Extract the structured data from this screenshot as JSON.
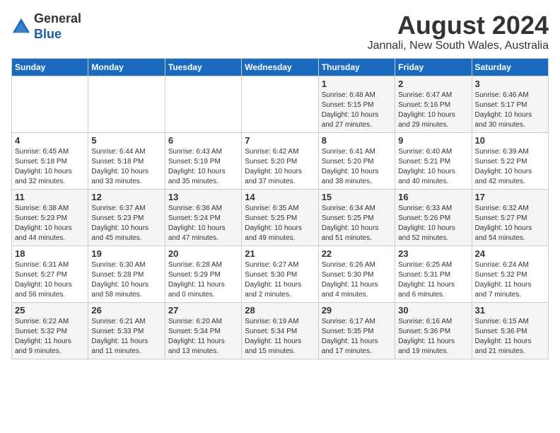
{
  "logo": {
    "general": "General",
    "blue": "Blue"
  },
  "title": {
    "month_year": "August 2024",
    "location": "Jannali, New South Wales, Australia"
  },
  "days_of_week": [
    "Sunday",
    "Monday",
    "Tuesday",
    "Wednesday",
    "Thursday",
    "Friday",
    "Saturday"
  ],
  "weeks": [
    [
      {
        "day": "",
        "info": ""
      },
      {
        "day": "",
        "info": ""
      },
      {
        "day": "",
        "info": ""
      },
      {
        "day": "",
        "info": ""
      },
      {
        "day": "1",
        "info": "Sunrise: 6:48 AM\nSunset: 5:15 PM\nDaylight: 10 hours\nand 27 minutes."
      },
      {
        "day": "2",
        "info": "Sunrise: 6:47 AM\nSunset: 5:16 PM\nDaylight: 10 hours\nand 29 minutes."
      },
      {
        "day": "3",
        "info": "Sunrise: 6:46 AM\nSunset: 5:17 PM\nDaylight: 10 hours\nand 30 minutes."
      }
    ],
    [
      {
        "day": "4",
        "info": "Sunrise: 6:45 AM\nSunset: 5:18 PM\nDaylight: 10 hours\nand 32 minutes."
      },
      {
        "day": "5",
        "info": "Sunrise: 6:44 AM\nSunset: 5:18 PM\nDaylight: 10 hours\nand 33 minutes."
      },
      {
        "day": "6",
        "info": "Sunrise: 6:43 AM\nSunset: 5:19 PM\nDaylight: 10 hours\nand 35 minutes."
      },
      {
        "day": "7",
        "info": "Sunrise: 6:42 AM\nSunset: 5:20 PM\nDaylight: 10 hours\nand 37 minutes."
      },
      {
        "day": "8",
        "info": "Sunrise: 6:41 AM\nSunset: 5:20 PM\nDaylight: 10 hours\nand 38 minutes."
      },
      {
        "day": "9",
        "info": "Sunrise: 6:40 AM\nSunset: 5:21 PM\nDaylight: 10 hours\nand 40 minutes."
      },
      {
        "day": "10",
        "info": "Sunrise: 6:39 AM\nSunset: 5:22 PM\nDaylight: 10 hours\nand 42 minutes."
      }
    ],
    [
      {
        "day": "11",
        "info": "Sunrise: 6:38 AM\nSunset: 5:23 PM\nDaylight: 10 hours\nand 44 minutes."
      },
      {
        "day": "12",
        "info": "Sunrise: 6:37 AM\nSunset: 5:23 PM\nDaylight: 10 hours\nand 45 minutes."
      },
      {
        "day": "13",
        "info": "Sunrise: 6:36 AM\nSunset: 5:24 PM\nDaylight: 10 hours\nand 47 minutes."
      },
      {
        "day": "14",
        "info": "Sunrise: 6:35 AM\nSunset: 5:25 PM\nDaylight: 10 hours\nand 49 minutes."
      },
      {
        "day": "15",
        "info": "Sunrise: 6:34 AM\nSunset: 5:25 PM\nDaylight: 10 hours\nand 51 minutes."
      },
      {
        "day": "16",
        "info": "Sunrise: 6:33 AM\nSunset: 5:26 PM\nDaylight: 10 hours\nand 52 minutes."
      },
      {
        "day": "17",
        "info": "Sunrise: 6:32 AM\nSunset: 5:27 PM\nDaylight: 10 hours\nand 54 minutes."
      }
    ],
    [
      {
        "day": "18",
        "info": "Sunrise: 6:31 AM\nSunset: 5:27 PM\nDaylight: 10 hours\nand 56 minutes."
      },
      {
        "day": "19",
        "info": "Sunrise: 6:30 AM\nSunset: 5:28 PM\nDaylight: 10 hours\nand 58 minutes."
      },
      {
        "day": "20",
        "info": "Sunrise: 6:28 AM\nSunset: 5:29 PM\nDaylight: 11 hours\nand 0 minutes."
      },
      {
        "day": "21",
        "info": "Sunrise: 6:27 AM\nSunset: 5:30 PM\nDaylight: 11 hours\nand 2 minutes."
      },
      {
        "day": "22",
        "info": "Sunrise: 6:26 AM\nSunset: 5:30 PM\nDaylight: 11 hours\nand 4 minutes."
      },
      {
        "day": "23",
        "info": "Sunrise: 6:25 AM\nSunset: 5:31 PM\nDaylight: 11 hours\nand 6 minutes."
      },
      {
        "day": "24",
        "info": "Sunrise: 6:24 AM\nSunset: 5:32 PM\nDaylight: 11 hours\nand 7 minutes."
      }
    ],
    [
      {
        "day": "25",
        "info": "Sunrise: 6:22 AM\nSunset: 5:32 PM\nDaylight: 11 hours\nand 9 minutes."
      },
      {
        "day": "26",
        "info": "Sunrise: 6:21 AM\nSunset: 5:33 PM\nDaylight: 11 hours\nand 11 minutes."
      },
      {
        "day": "27",
        "info": "Sunrise: 6:20 AM\nSunset: 5:34 PM\nDaylight: 11 hours\nand 13 minutes."
      },
      {
        "day": "28",
        "info": "Sunrise: 6:19 AM\nSunset: 5:34 PM\nDaylight: 11 hours\nand 15 minutes."
      },
      {
        "day": "29",
        "info": "Sunrise: 6:17 AM\nSunset: 5:35 PM\nDaylight: 11 hours\nand 17 minutes."
      },
      {
        "day": "30",
        "info": "Sunrise: 6:16 AM\nSunset: 5:36 PM\nDaylight: 11 hours\nand 19 minutes."
      },
      {
        "day": "31",
        "info": "Sunrise: 6:15 AM\nSunset: 5:36 PM\nDaylight: 11 hours\nand 21 minutes."
      }
    ]
  ]
}
